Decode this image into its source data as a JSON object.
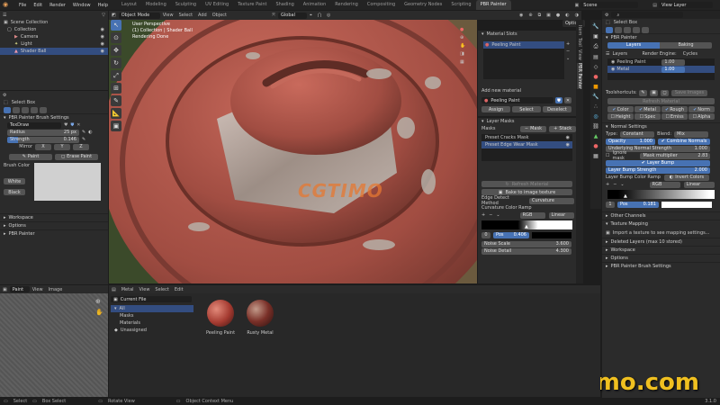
{
  "menu": {
    "app_icon": "blender-icon",
    "items": [
      "File",
      "Edit",
      "Render",
      "Window",
      "Help"
    ],
    "tabs": [
      "Layout",
      "Modeling",
      "Sculpting",
      "UV Editing",
      "Texture Paint",
      "Shading",
      "Animation",
      "Rendering",
      "Compositing",
      "Geometry Nodes",
      "Scripting",
      "PBR Painter"
    ],
    "active_tab": "PBR Painter",
    "scene": "Scene",
    "view_layer": "View Layer"
  },
  "outliner": {
    "items": [
      "Scene Collection",
      "Collection",
      "Camera",
      "Light",
      "Shader Ball"
    ]
  },
  "brush": {
    "tool_name": "Select Box",
    "section": "PBR Painter Brush Settings",
    "brush_name": "TexDraw",
    "radius_label": "Radius",
    "radius_value": "25 px",
    "strength_label": "Strength",
    "strength_value": "0.146",
    "mirror_label": "Mirror",
    "mirror_x": "X",
    "mirror_y": "Y",
    "mirror_z": "Z",
    "paint_label": "Paint",
    "erase_label": "Erase Paint",
    "brush_color_label": "Brush Color",
    "white_label": "White",
    "black_label": "Black",
    "workspace": "Workspace",
    "options": "Options",
    "pbr_painter": "PBR Painter"
  },
  "viewport": {
    "mode": "Object Mode",
    "menus": [
      "View",
      "Select",
      "Add",
      "Object"
    ],
    "orientation": "Global",
    "overlay_lines": [
      "User Perspective",
      "(1) Collection | Shader Ball",
      "Rendering Done"
    ],
    "options": "Options",
    "watermark": "CGTIMO"
  },
  "material_panel": {
    "title": "Material Slots",
    "slot": "Peeling Paint",
    "add_label": "Add new material",
    "material_name": "Peeling Paint",
    "assign": "Assign",
    "select": "Select",
    "deselect": "Deselect"
  },
  "layer_masks": {
    "title": "Layer Masks",
    "masks_label": "Masks",
    "mask_btn": "Mask",
    "stack_btn": "Stack",
    "items": [
      "Preset Cracks Mask",
      "Preset Edge Wear Mask"
    ],
    "refresh": "Refresh Material",
    "bake": "Bake to image texture",
    "edge_method_label": "Edge Detect Method",
    "edge_method_value": "Curvature",
    "ramp_title": "Curvature Color Ramp",
    "ramp_mode": "RGB",
    "ramp_interp": "Linear",
    "stop_index": "0",
    "pos_label": "Pos",
    "pos_value": "0.406",
    "noise_scale_label": "Noise Scale",
    "noise_scale_value": "3.600",
    "noise_detail_label": "Noise Detail",
    "noise_detail_value": "4.300"
  },
  "bottom_left": {
    "editor": "Paint",
    "menus": [
      "View",
      "Image"
    ]
  },
  "asset_browser": {
    "menus": [
      "Metal",
      "View",
      "Select",
      "Edit"
    ],
    "library": "Current File",
    "categories": [
      "All",
      "Masks",
      "Materials",
      "Unassigned"
    ],
    "items": [
      "Peeling Paint",
      "Rusty Metal"
    ]
  },
  "right_panel": {
    "tool_name": "Select Box",
    "pbr_title": "PBR Painter",
    "tab_layers": "Layers",
    "tab_baking": "Baking",
    "render_engine_label": "Render Engine:",
    "render_engine_value": "Cycles",
    "layers_label": "Layers",
    "layers": [
      {
        "name": "Peeling Paint",
        "value": "1.00"
      },
      {
        "name": "Metal",
        "value": "1.00"
      }
    ],
    "toolshortcuts_label": "Toolshortcuts:",
    "save_images": "Save Images",
    "refresh_material": "Refresh Material",
    "channels": [
      "Color",
      "Metal",
      "Rough",
      "Norm",
      "Height",
      "Spec",
      "Emiss",
      "Alpha"
    ],
    "normal_settings": "Normal Settings",
    "type_label": "Type:",
    "type_value": "Constant",
    "blend_label": "Blend:",
    "blend_value": "Mix",
    "opacity_label": "Opacity",
    "opacity_value": "1.000",
    "combine_normals": "Combine Normals",
    "underlying_label": "Underlying Normal Strength",
    "underlying_value": "1.000",
    "ignore_mask": "Ignore mask",
    "mask_mult_label": "Mask multiplier",
    "mask_mult_value": "2.83",
    "layer_bump": "Layer Bump",
    "bump_strength_label": "Layer Bump Strength",
    "bump_strength_value": "2.000",
    "bump_ramp_label": "Layer Bump Color Ramp",
    "invert_colors": "Invert Colors",
    "ramp_mode": "RGB",
    "ramp_interp": "Linear",
    "stop_index": "1",
    "pos_label": "Pos",
    "pos_value": "0.181",
    "other_channels": "Other Channels",
    "texture_mapping": "Texture Mapping",
    "import_texture": "Import a texture to see mapping settings...",
    "deleted_layers": "Deleted Layers (max 10 stored)",
    "workspace": "Workspace",
    "options": "Options",
    "brush_settings": "PBR Painter Brush Settings",
    "vtabs": [
      "Item",
      "Tool",
      "View",
      "PBR Painter"
    ],
    "watermark": "CGtimo.com"
  },
  "statusbar": {
    "items": [
      "Select",
      "Box Select",
      "Rotate View",
      "Object Context Menu"
    ],
    "version": "3.1.0"
  },
  "colors": {
    "accent": "#4772b3",
    "watermark": "#f0c020",
    "paint_red": "#b85a4e"
  }
}
